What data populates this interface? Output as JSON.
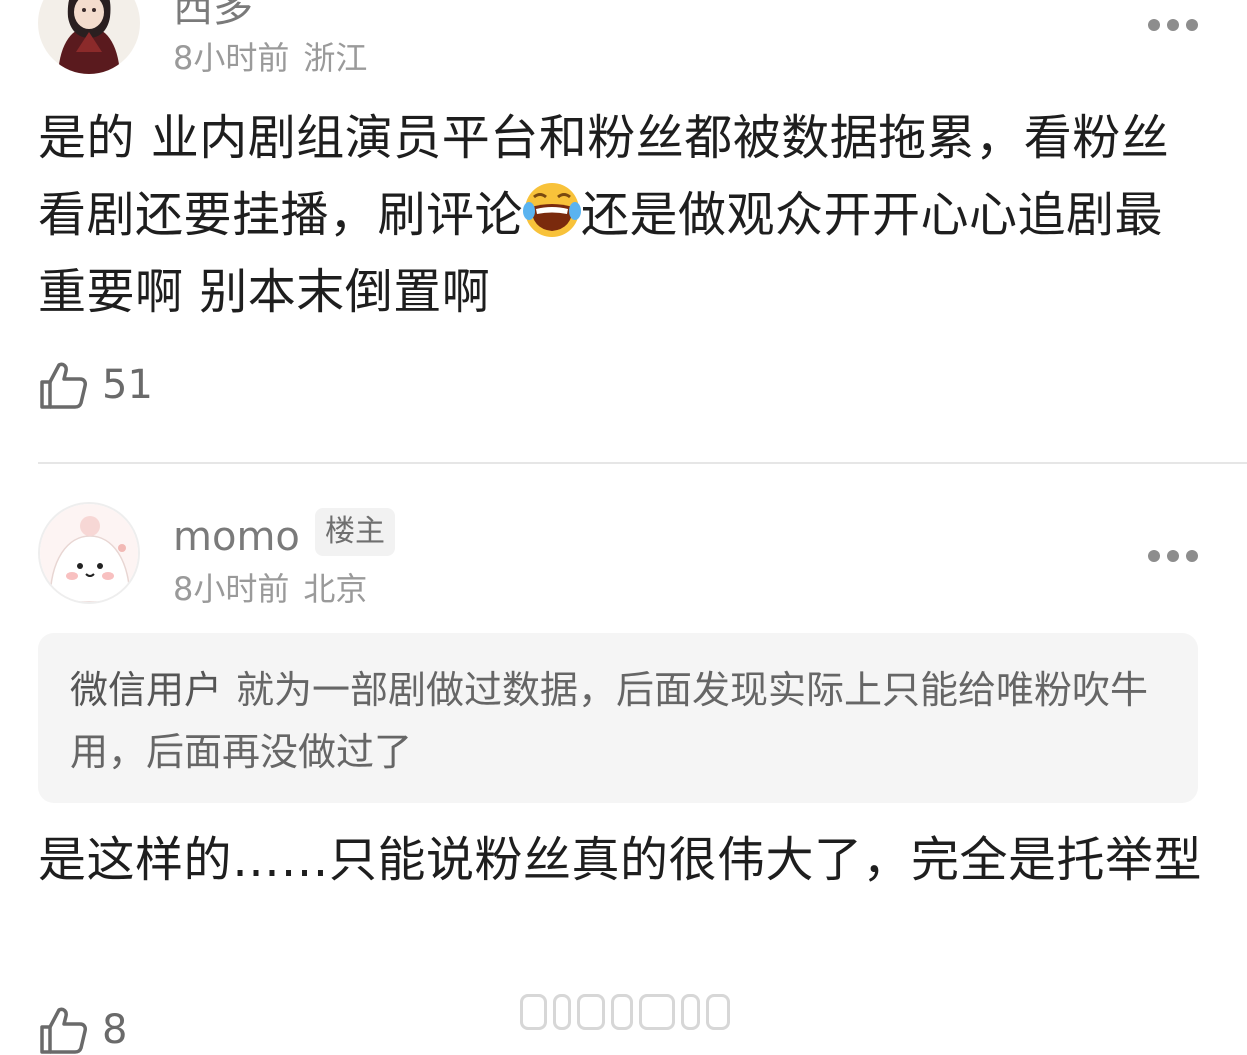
{
  "comments": [
    {
      "username": "西多",
      "time": "8小时前",
      "location": "浙江",
      "text_before_emoji": "是的 业内剧组演员平台和粉丝都被数据拖累，看粉丝看剧还要挂播，刷评论",
      "emoji": "laughing-crying-emoji",
      "text_after_emoji": "还是做观众开开心心追剧最重要啊 别本末倒置啊",
      "likes": "51"
    },
    {
      "username": "momo",
      "badge": "楼主",
      "time": "8小时前",
      "location": "北京",
      "quote": {
        "author": "微信用户",
        "text": "就为一部剧做过数据，后面发现实际上只能给唯粉吹牛用，后面再没做过了"
      },
      "text": "是这样的……只能说粉丝真的很伟大了，完全是托举型",
      "likes": "8"
    }
  ],
  "icons": {
    "more": "more-dots-icon",
    "like": "thumbs-up-icon"
  },
  "colors": {
    "meta_text": "#9a9a9a",
    "quote_bg": "#f5f5f5",
    "divider": "#e6e6e6"
  }
}
